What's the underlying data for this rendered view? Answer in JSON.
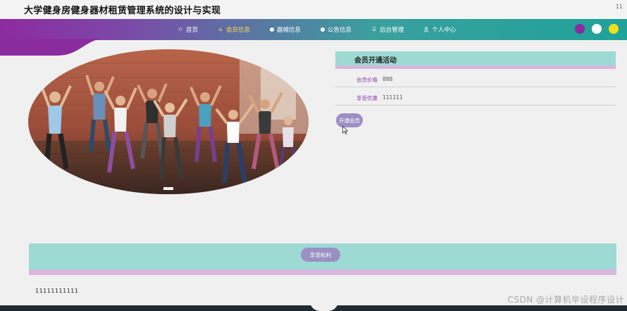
{
  "header": {
    "site_title": "大学健身房健身器材租赁管理系统的设计与实现",
    "corner_number": "11"
  },
  "nav": {
    "items": [
      {
        "label": "首页",
        "icon": "star-icon"
      },
      {
        "label": "会员信息",
        "icon": "home-icon",
        "active": true
      },
      {
        "label": "器械信息",
        "icon": "dot-icon"
      },
      {
        "label": "公告信息",
        "icon": "dot-icon"
      },
      {
        "label": "后台管理",
        "icon": "building-icon"
      },
      {
        "label": "个人中心",
        "icon": "user-icon"
      }
    ],
    "theme_colors": [
      "#8e2aa0",
      "#ffffff",
      "#f2e01a"
    ],
    "accent_color": "#f4e04a"
  },
  "panel": {
    "title": "会员开通活动",
    "rows": [
      {
        "label": "会员价格",
        "value": "888"
      },
      {
        "label": "享受优惠",
        "value": "111111"
      }
    ],
    "open_button": "开通会员"
  },
  "band": {
    "button": "享受权利"
  },
  "footer": {
    "text": "11111111111"
  },
  "watermark": "CSDN @计算机毕设程序设计",
  "colors": {
    "panel_header": "#9edad4",
    "panel_stripe": "#d8b6de",
    "button": "#9b90c4"
  }
}
